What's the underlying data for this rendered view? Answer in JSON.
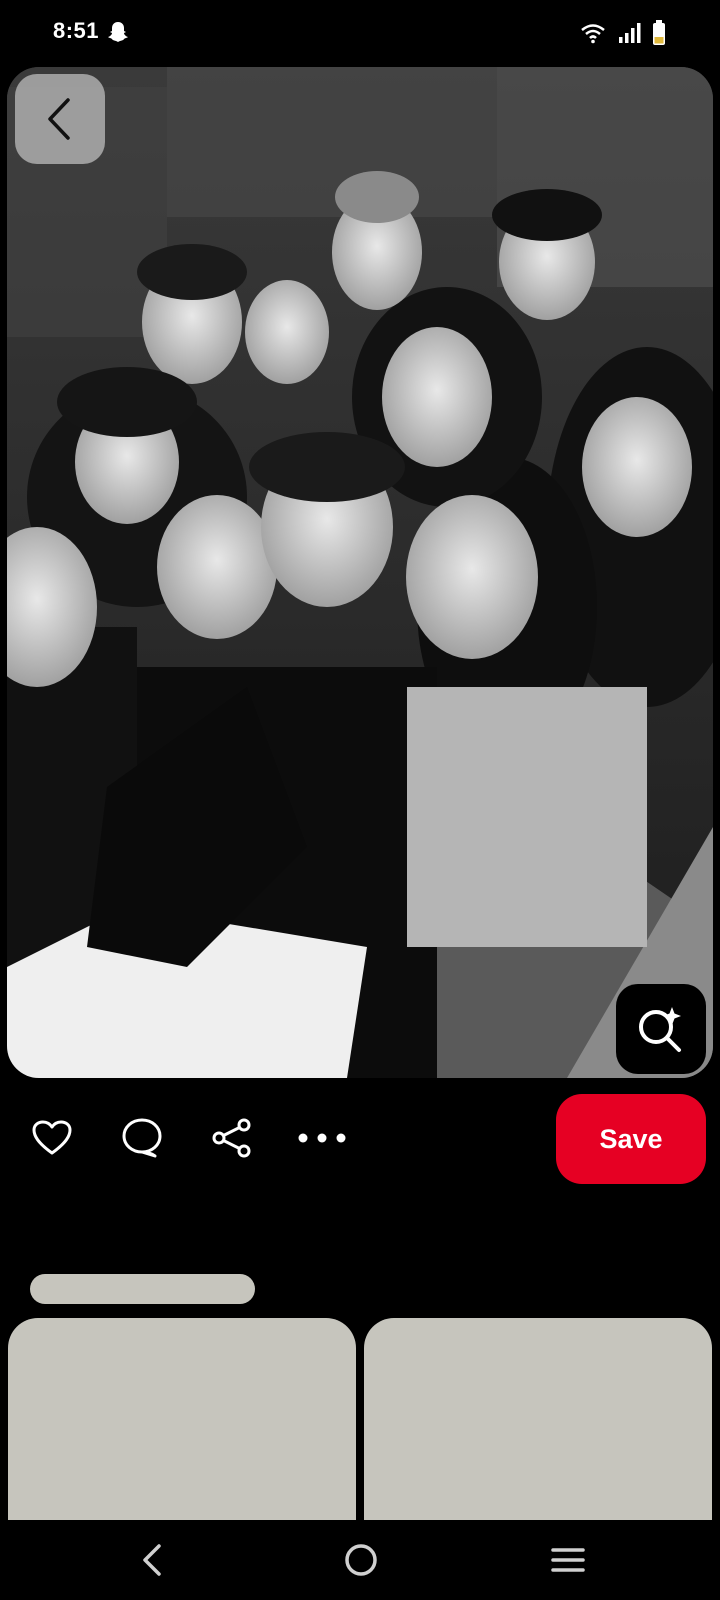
{
  "status_bar": {
    "time": "8:51",
    "icons": [
      "snapchat-icon",
      "wifi-icon",
      "signal-icon",
      "battery-icon"
    ]
  },
  "pin": {
    "image_description_icon": "group-selfie-photo",
    "back_icon": "chevron-left-icon",
    "lens_icon": "visual-search-icon"
  },
  "actions": {
    "icons": [
      "heart-icon",
      "comment-icon",
      "share-icon",
      "more-icon"
    ],
    "save_label": "Save"
  },
  "colors": {
    "background": "#000000",
    "accent": "#e60023",
    "placeholder": "#c6c5bd"
  },
  "nav": {
    "icons": [
      "nav-back-icon",
      "nav-home-icon",
      "nav-recents-icon"
    ]
  }
}
